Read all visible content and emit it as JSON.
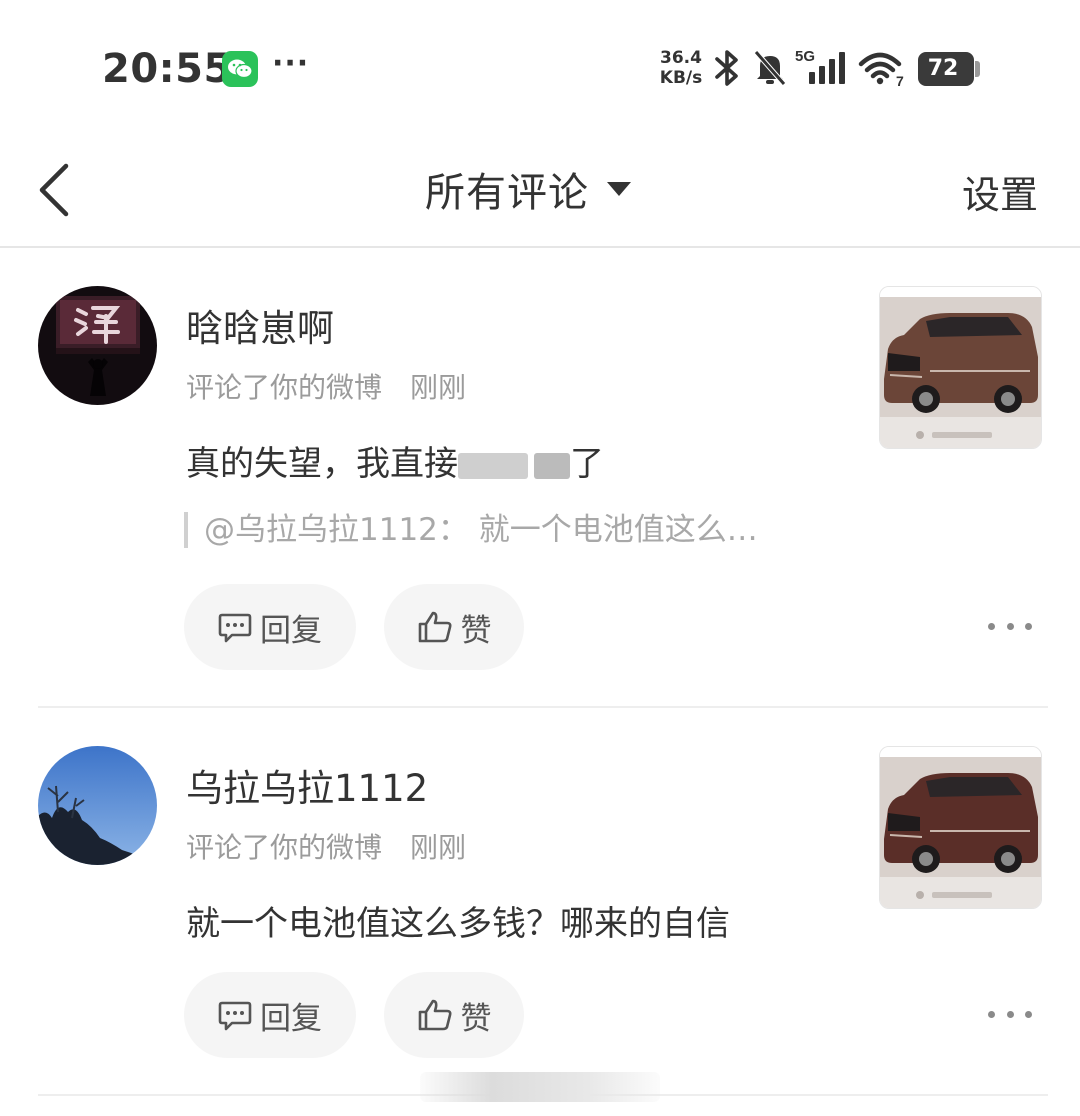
{
  "status_bar": {
    "time": "20:55",
    "net_speed_value": "36.4",
    "net_speed_unit": "KB/s",
    "signal_label": "5G",
    "wifi_label": "7",
    "battery": "72"
  },
  "nav": {
    "title": "所有评论",
    "settings": "设置"
  },
  "comments": [
    {
      "user": "晗晗崽啊",
      "action": "评论了你的微博",
      "time": "刚刚",
      "text_before": "真的失望，我直接",
      "text_after": "了",
      "quote": "@乌拉乌拉1112： 就一个电池值这么…",
      "reply_label": "回复",
      "like_label": "赞"
    },
    {
      "user": "乌拉乌拉1112",
      "action": "评论了你的微博",
      "time": "刚刚",
      "text": "就一个电池值这么多钱？哪来的自信",
      "reply_label": "回复",
      "like_label": "赞"
    }
  ],
  "colors": {
    "text_primary": "#333333",
    "text_secondary": "#9b9b9b",
    "pill_bg": "#f5f5f5",
    "wechat_green": "#2bc25a"
  }
}
